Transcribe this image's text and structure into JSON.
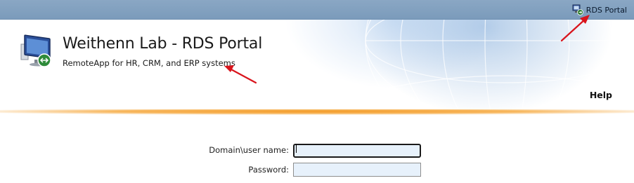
{
  "topbar": {
    "portal_link_label": "RDS Portal",
    "portal_link_icon": "remote-desktop-icon"
  },
  "banner": {
    "logo_icon": "remote-desktop-computer-icon",
    "title": "Weithenn Lab - RDS Portal",
    "subtitle": "RemoteApp for HR, CRM, and ERP systems",
    "help_label": "Help"
  },
  "login_form": {
    "username_label": "Domain\\user name:",
    "username_value": "",
    "password_label": "Password:",
    "password_value": ""
  },
  "annotations": {
    "arrow_color": "#d9141c",
    "arrows": [
      "arrow pointing to RDS Portal link",
      "arrow pointing to subtitle"
    ]
  },
  "colors": {
    "topbar": "#7f9fbf",
    "accent_rule": "#f39c2a",
    "field_bg": "#e7f1fb"
  }
}
